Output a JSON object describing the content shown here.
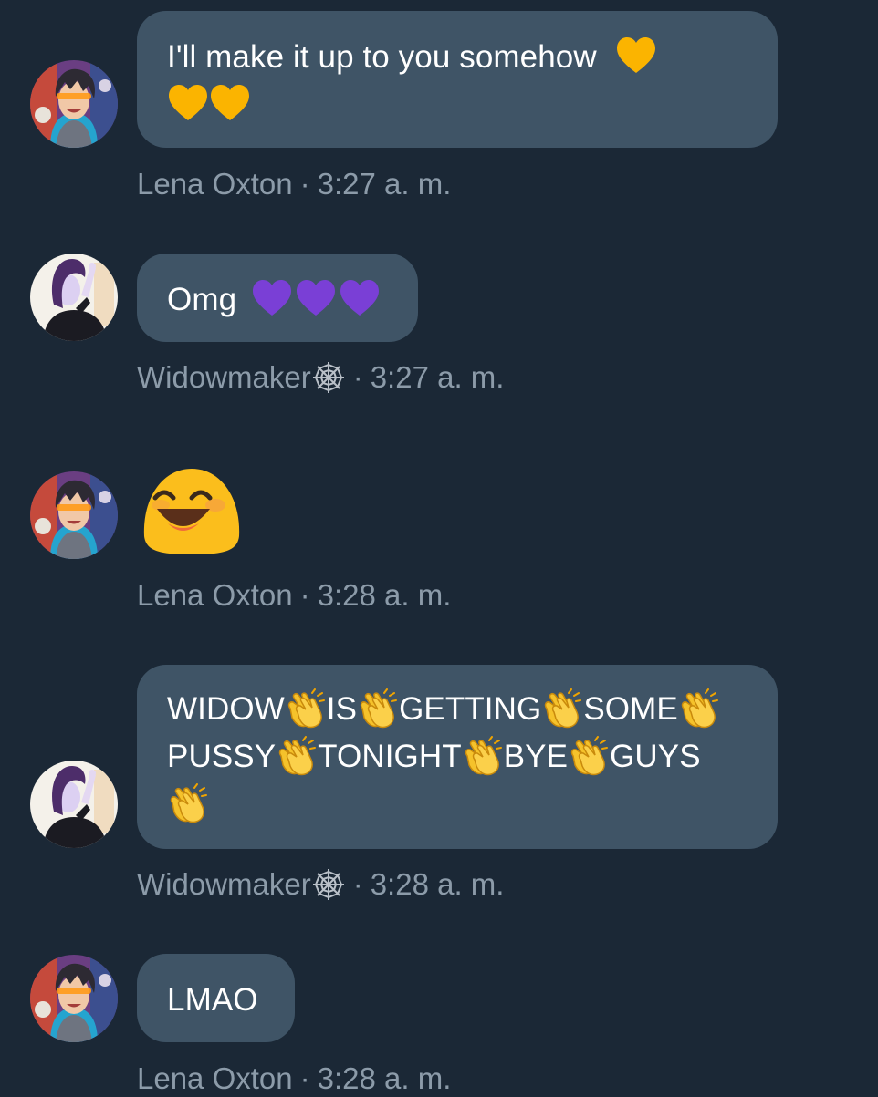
{
  "colors": {
    "background": "#1b2836",
    "bubble": "#3f5466",
    "meta_text": "#8c9ba9",
    "yellow_heart": "#fbb400",
    "purple_heart": "#7a3fd6",
    "clap": "#f6c12a"
  },
  "messages": [
    {
      "author": "Lena Oxton",
      "avatar_icon": "tracer-avatar-icon",
      "text": "I'll make it up to you somehow",
      "emoji": "yellow-heart-icon x3",
      "separator": "·",
      "time": "3:27 a. m."
    },
    {
      "author": "Widowmaker",
      "author_emoji": "spider-web-icon",
      "avatar_icon": "widowmaker-avatar-icon",
      "text": "Omg",
      "emoji": "purple-heart-icon x3",
      "separator": "·",
      "time": "3:27 a. m."
    },
    {
      "author": "Lena Oxton",
      "avatar_icon": "tracer-avatar-icon",
      "emoji": "grinning-face-icon",
      "separator": "·",
      "time": "3:28 a. m."
    },
    {
      "author": "Widowmaker",
      "author_emoji": "spider-web-icon",
      "avatar_icon": "widowmaker-avatar-icon",
      "words": [
        "WIDOW",
        "IS",
        "GETTING",
        "SOME",
        "PUSSY",
        "TONIGHT",
        "BYE",
        "GUYS"
      ],
      "emoji": "clapping-hands-icon",
      "separator": "·",
      "time": "3:28 a. m."
    },
    {
      "author": "Lena Oxton",
      "avatar_icon": "tracer-avatar-icon",
      "text": "LMAO",
      "separator": "·",
      "time": "3:28 a. m."
    }
  ]
}
